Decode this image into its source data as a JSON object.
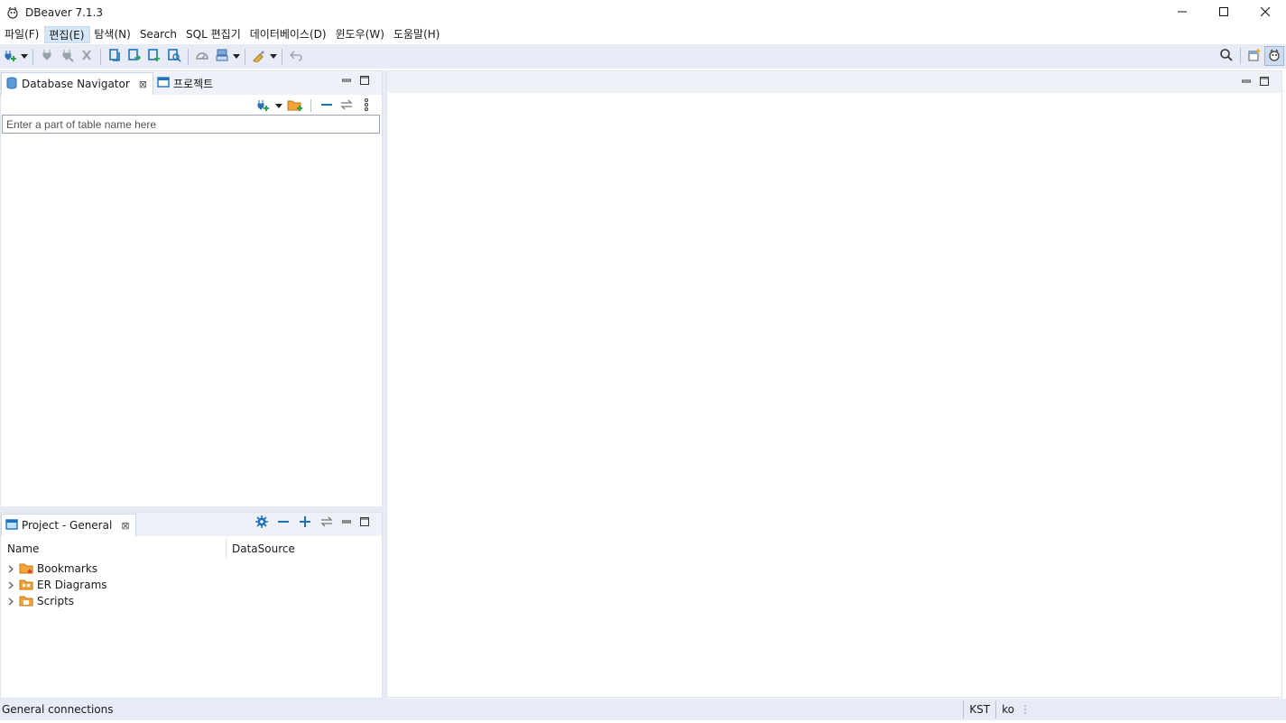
{
  "window": {
    "title": "DBeaver 7.1.3",
    "minimize_icon": "minimize-icon",
    "maximize_icon": "maximize-icon",
    "close_icon": "close-icon"
  },
  "menu": {
    "items": [
      "파일(F)",
      "편집(E)",
      "탐색(N)",
      "Search",
      "SQL 편집기",
      "데이터베이스(D)",
      "윈도우(W)",
      "도움말(H)"
    ],
    "active_index": 1
  },
  "toolbar": {
    "icons": [
      "new-connection-icon",
      "connect-icon",
      "disconnect-icon",
      "invalidate-icon",
      "commit-icon",
      "rollback-icon",
      "transaction-mode-icon",
      "tx-log-icon",
      "dashboard-icon",
      "sql-editor-icon",
      "format-icon",
      "back-icon"
    ],
    "right_icons": [
      "search-icon",
      "open-perspective-icon",
      "dbeaver-perspective-icon"
    ]
  },
  "navigator": {
    "tab_label": "Database Navigator",
    "tab2_label": "프로젝트",
    "filter_placeholder": "Enter a part of table name here"
  },
  "project": {
    "tab_label": "Project - General",
    "columns": [
      "Name",
      "DataSource"
    ],
    "items": [
      {
        "label": "Bookmarks",
        "icon": "bookmarks-folder-icon"
      },
      {
        "label": "ER Diagrams",
        "icon": "er-diagrams-folder-icon"
      },
      {
        "label": "Scripts",
        "icon": "scripts-folder-icon"
      }
    ]
  },
  "status": {
    "left": "General connections",
    "timezone": "KST",
    "locale": "ko"
  },
  "colors": {
    "toolbar_bg": "#e6ebf6",
    "accent": "#1e73be",
    "folder": "#e8912f"
  }
}
